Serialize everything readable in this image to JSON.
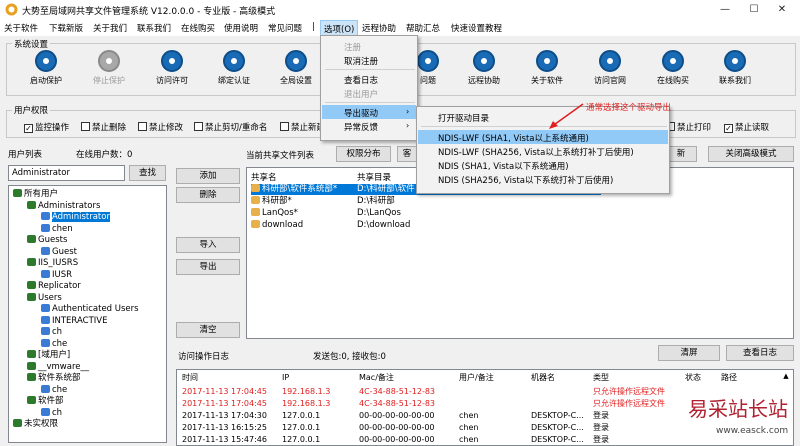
{
  "window": {
    "title": "大势至局域网共享文件管理系统 V12.0.0.0 - 专业版 - 高级模式"
  },
  "menu": [
    "关于软件",
    "下载新版",
    "关于我们",
    "联系我们",
    "在线购买",
    "使用说明",
    "常见问题",
    "|",
    "选项(O)",
    "远程协助",
    "帮助汇总",
    "快速设置教程"
  ],
  "sysgroup": {
    "label": "系统设置"
  },
  "tools": [
    {
      "label": "启动保护",
      "disabled": false
    },
    {
      "label": "停止保护",
      "disabled": true
    },
    {
      "label": "访问许可",
      "disabled": false
    },
    {
      "label": "绑定认证",
      "disabled": false
    },
    {
      "label": "全局设置",
      "disabled": false
    },
    {
      "label": "问题",
      "disabled": false
    },
    {
      "label": "远程协助",
      "disabled": false
    },
    {
      "label": "关于软件",
      "disabled": false
    },
    {
      "label": "访问官网",
      "disabled": false
    },
    {
      "label": "在线购买",
      "disabled": false
    },
    {
      "label": "联系我们",
      "disabled": false
    }
  ],
  "permgroup": {
    "label": "用户权限"
  },
  "perms": [
    {
      "label": "监控操作",
      "checked": true
    },
    {
      "label": "禁止删除",
      "checked": false
    },
    {
      "label": "禁止修改",
      "checked": false
    },
    {
      "label": "禁止剪切/重命名",
      "checked": false
    },
    {
      "label": "禁止新建",
      "checked": false
    },
    {
      "label": "禁止打印",
      "checked": false
    },
    {
      "label": "禁止读取",
      "checked": true
    }
  ],
  "users": {
    "label": "用户列表",
    "online_label": "在线用户数：0",
    "search_value": "Administrator",
    "search_button": "查找"
  },
  "tree": [
    {
      "label": "所有用户",
      "level": 0,
      "type": "grp"
    },
    {
      "label": "Administrators",
      "level": 1,
      "type": "grp"
    },
    {
      "label": "Administrator",
      "level": 2,
      "type": "usr",
      "selected": true
    },
    {
      "label": "chen",
      "level": 2,
      "type": "usr"
    },
    {
      "label": "Guests",
      "level": 1,
      "type": "grp"
    },
    {
      "label": "Guest",
      "level": 2,
      "type": "usr"
    },
    {
      "label": "IIS_IUSRS",
      "level": 1,
      "type": "grp"
    },
    {
      "label": "IUSR",
      "level": 2,
      "type": "usr"
    },
    {
      "label": "Replicator",
      "level": 1,
      "type": "grp"
    },
    {
      "label": "Users",
      "level": 1,
      "type": "grp"
    },
    {
      "label": "Authenticated Users",
      "level": 2,
      "type": "usr"
    },
    {
      "label": "INTERACTIVE",
      "level": 2,
      "type": "usr"
    },
    {
      "label": "ch",
      "level": 2,
      "type": "usr"
    },
    {
      "label": "che",
      "level": 2,
      "type": "usr"
    },
    {
      "label": "[域用户]",
      "level": 1,
      "type": "grp"
    },
    {
      "label": "__vmware__",
      "level": 1,
      "type": "grp"
    },
    {
      "label": "软件系统部",
      "level": 1,
      "type": "grp"
    },
    {
      "label": "che",
      "level": 2,
      "type": "usr"
    },
    {
      "label": "软件部",
      "level": 1,
      "type": "grp"
    },
    {
      "label": "ch",
      "level": 2,
      "type": "usr"
    },
    {
      "label": "未实权限",
      "level": 0,
      "type": "grp"
    }
  ],
  "mid_buttons": {
    "add": "添加",
    "del": "删除",
    "import": "导入",
    "export": "导出",
    "clear": "清空"
  },
  "shares": {
    "label": "当前共享文件列表",
    "dist_button": "权限分布",
    "partial_button": "客",
    "right_button_partial": "新",
    "adv_button": "关闭高级模式",
    "col_name": "共享名",
    "col_dir": "共享目录",
    "rows": [
      {
        "name": "科研部\\软件系统部*",
        "dir": "D:\\科研部\\软件",
        "selected": true
      },
      {
        "name": "科研部*",
        "dir": "D:\\科研部"
      },
      {
        "name": "LanQos*",
        "dir": "D:\\LanQos"
      },
      {
        "name": "download",
        "dir": "D:\\download"
      }
    ]
  },
  "log": {
    "label": "访问操作日志",
    "stats": "发送包:0, 接收包:0",
    "clear_button": "清屏",
    "view_button": "查看日志",
    "cols": [
      "时间",
      "IP",
      "Mac/备注",
      "用户/备注",
      "机器名",
      "类型",
      "状态",
      "路径"
    ],
    "rows": [
      {
        "time": "2017-11-13 17:04:45",
        "ip": "192.168.1.3",
        "mac": "4C-34-88-51-12-83",
        "user": "",
        "machine": "",
        "type": "只允许操作远程文件",
        "red": true
      },
      {
        "time": "2017-11-13 17:04:45",
        "ip": "192.168.1.3",
        "mac": "4C-34-88-51-12-83",
        "user": "",
        "machine": "",
        "type": "只允许操作远程文件",
        "red": true
      },
      {
        "time": "2017-11-13 17:04:30",
        "ip": "127.0.0.1",
        "mac": "00-00-00-00-00-00",
        "user": "chen",
        "machine": "DESKTOP-C...",
        "type": "登录",
        "red": false
      },
      {
        "time": "2017-11-13 16:15:25",
        "ip": "127.0.0.1",
        "mac": "00-00-00-00-00-00",
        "user": "chen",
        "machine": "DESKTOP-C...",
        "type": "登录",
        "red": false
      },
      {
        "time": "2017-11-13 15:47:46",
        "ip": "127.0.0.1",
        "mac": "00-00-00-00-00-00",
        "user": "chen",
        "machine": "DESKTOP-C...",
        "type": "登录",
        "red": false
      }
    ]
  },
  "options_menu": [
    {
      "label": "注册",
      "disabled": true
    },
    {
      "label": "取消注册",
      "disabled": false
    },
    {
      "label": "sep"
    },
    {
      "label": "查看日志",
      "disabled": false
    },
    {
      "label": "退出用户",
      "disabled": true
    },
    {
      "label": "sep"
    },
    {
      "label": "导出驱动",
      "disabled": false,
      "sub": true,
      "highlight": true
    },
    {
      "label": "异常反馈",
      "disabled": false,
      "sub": true
    }
  ],
  "driver_menu": [
    {
      "label": "打开驱动目录",
      "highlight": false
    },
    {
      "label": "sep"
    },
    {
      "label": "NDIS-LWF (SHA1, Vista以上系统通用)",
      "highlight": true
    },
    {
      "label": "NDIS-LWF (SHA256, Vista以上系统打补丁后使用)",
      "highlight": false
    },
    {
      "label": "NDIS (SHA1, Vista以下系统通用)",
      "highlight": false
    },
    {
      "label": "NDIS (SHA256, Vista以下系统打补丁后使用)",
      "highlight": false
    }
  ],
  "annotation": "通常选择这个驱动导出",
  "watermark": {
    "text": "易采站长站",
    "url": "www.easck.com"
  },
  "colors": {
    "accent": "#1a6bb5",
    "highlight": "#91c9f7",
    "red": "#e02020"
  }
}
